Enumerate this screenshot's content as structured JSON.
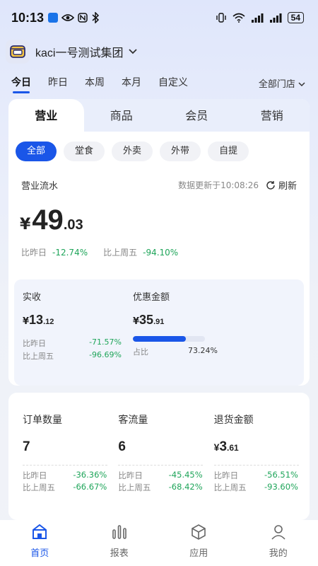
{
  "status_bar": {
    "time": "10:13",
    "battery": "54",
    "left_icons": [
      "app-icon",
      "eye-icon",
      "nfc-icon",
      "bluetooth-icon"
    ],
    "right_icons": [
      "vibrate-icon",
      "wifi-icon",
      "signal-icon",
      "signal-icon",
      "battery-icon"
    ]
  },
  "header": {
    "org_name": "kaci一号测试集团"
  },
  "period_tabs": [
    {
      "label": "今日",
      "active": true
    },
    {
      "label": "昨日",
      "active": false
    },
    {
      "label": "本周",
      "active": false
    },
    {
      "label": "本月",
      "active": false
    },
    {
      "label": "自定义",
      "active": false
    }
  ],
  "store_select": "全部门店",
  "main_tabs": [
    {
      "label": "营业",
      "active": true
    },
    {
      "label": "商品",
      "active": false
    },
    {
      "label": "会员",
      "active": false
    },
    {
      "label": "营销",
      "active": false
    }
  ],
  "channels": [
    {
      "label": "全部",
      "active": true
    },
    {
      "label": "堂食",
      "active": false
    },
    {
      "label": "外卖",
      "active": false
    },
    {
      "label": "外带",
      "active": false
    },
    {
      "label": "自提",
      "active": false
    }
  ],
  "flow": {
    "title": "营业流水",
    "updated": "数据更新于10:08:26",
    "refresh_label": "刷新",
    "yen": "¥",
    "amount_int": "49",
    "amount_dec": ".03",
    "cmp_yesterday_label": "比昨日",
    "cmp_yesterday_value": "-12.74%",
    "cmp_lastweek_label": "比上周五",
    "cmp_lastweek_value": "-94.10%"
  },
  "received": {
    "label": "实收",
    "yen": "¥",
    "int": "13",
    "dec": ".12",
    "cmp_yesterday_label": "比昨日",
    "cmp_yesterday_value": "-71.57%",
    "cmp_lastweek_label": "比上周五",
    "cmp_lastweek_value": "-96.69%"
  },
  "discount": {
    "label": "优惠金额",
    "yen": "¥",
    "int": "35",
    "dec": ".91",
    "ratio_label": "占比",
    "ratio_value": "73.24%",
    "ratio_fraction": 0.7324
  },
  "metrics": [
    {
      "label": "订单数量",
      "value": "7",
      "cmp_yesterday_label": "比昨日",
      "cmp_yesterday_value": "-36.36%",
      "cmp_lastweek_label": "比上周五",
      "cmp_lastweek_value": "-66.67%"
    },
    {
      "label": "客流量",
      "value": "6",
      "cmp_yesterday_label": "比昨日",
      "cmp_yesterday_value": "-45.45%",
      "cmp_lastweek_label": "比上周五",
      "cmp_lastweek_value": "-68.42%"
    },
    {
      "label": "退货金额",
      "yen": "¥",
      "int": "3",
      "dec": ".61",
      "cmp_yesterday_label": "比昨日",
      "cmp_yesterday_value": "-56.51%",
      "cmp_lastweek_label": "比上周五",
      "cmp_lastweek_value": "-93.60%"
    }
  ],
  "bottom_nav": [
    {
      "label": "首页",
      "icon": "home-icon",
      "active": true
    },
    {
      "label": "报表",
      "icon": "report-icon",
      "active": false
    },
    {
      "label": "应用",
      "icon": "apps-icon",
      "active": false
    },
    {
      "label": "我的",
      "icon": "profile-icon",
      "active": false
    }
  ],
  "colors": {
    "accent": "#1a56e8",
    "positive": "#1fa55a"
  }
}
